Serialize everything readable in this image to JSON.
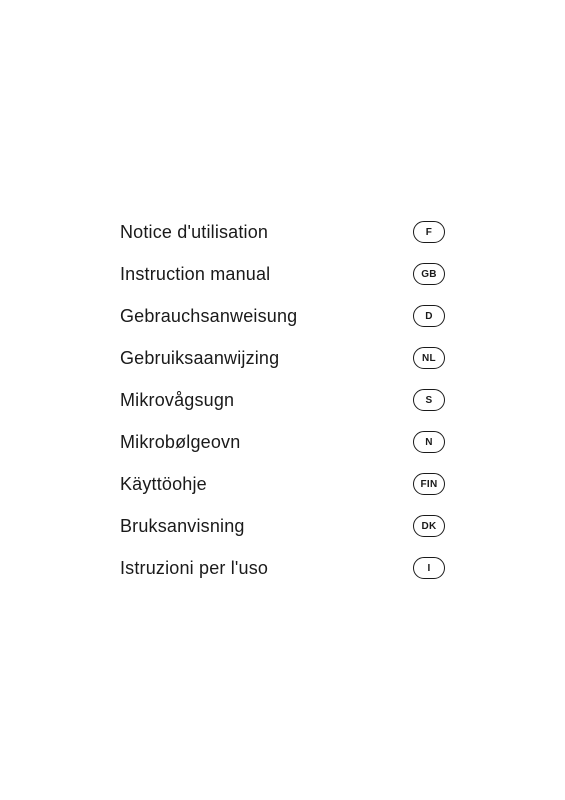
{
  "entries": [
    {
      "label": "Notice d'utilisation",
      "badge": "F"
    },
    {
      "label": "Instruction manual",
      "badge": "GB"
    },
    {
      "label": "Gebrauchsanweisung",
      "badge": "D"
    },
    {
      "label": "Gebruiksaanwijzing",
      "badge": "NL"
    },
    {
      "label": "Mikrovågsugn",
      "badge": "S"
    },
    {
      "label": "Mikrobølgeovn",
      "badge": "N"
    },
    {
      "label": "Käyttöohje",
      "badge": "FIN"
    },
    {
      "label": "Bruksanvisning",
      "badge": "DK"
    },
    {
      "label": "Istruzioni per l'uso",
      "badge": "I"
    }
  ]
}
